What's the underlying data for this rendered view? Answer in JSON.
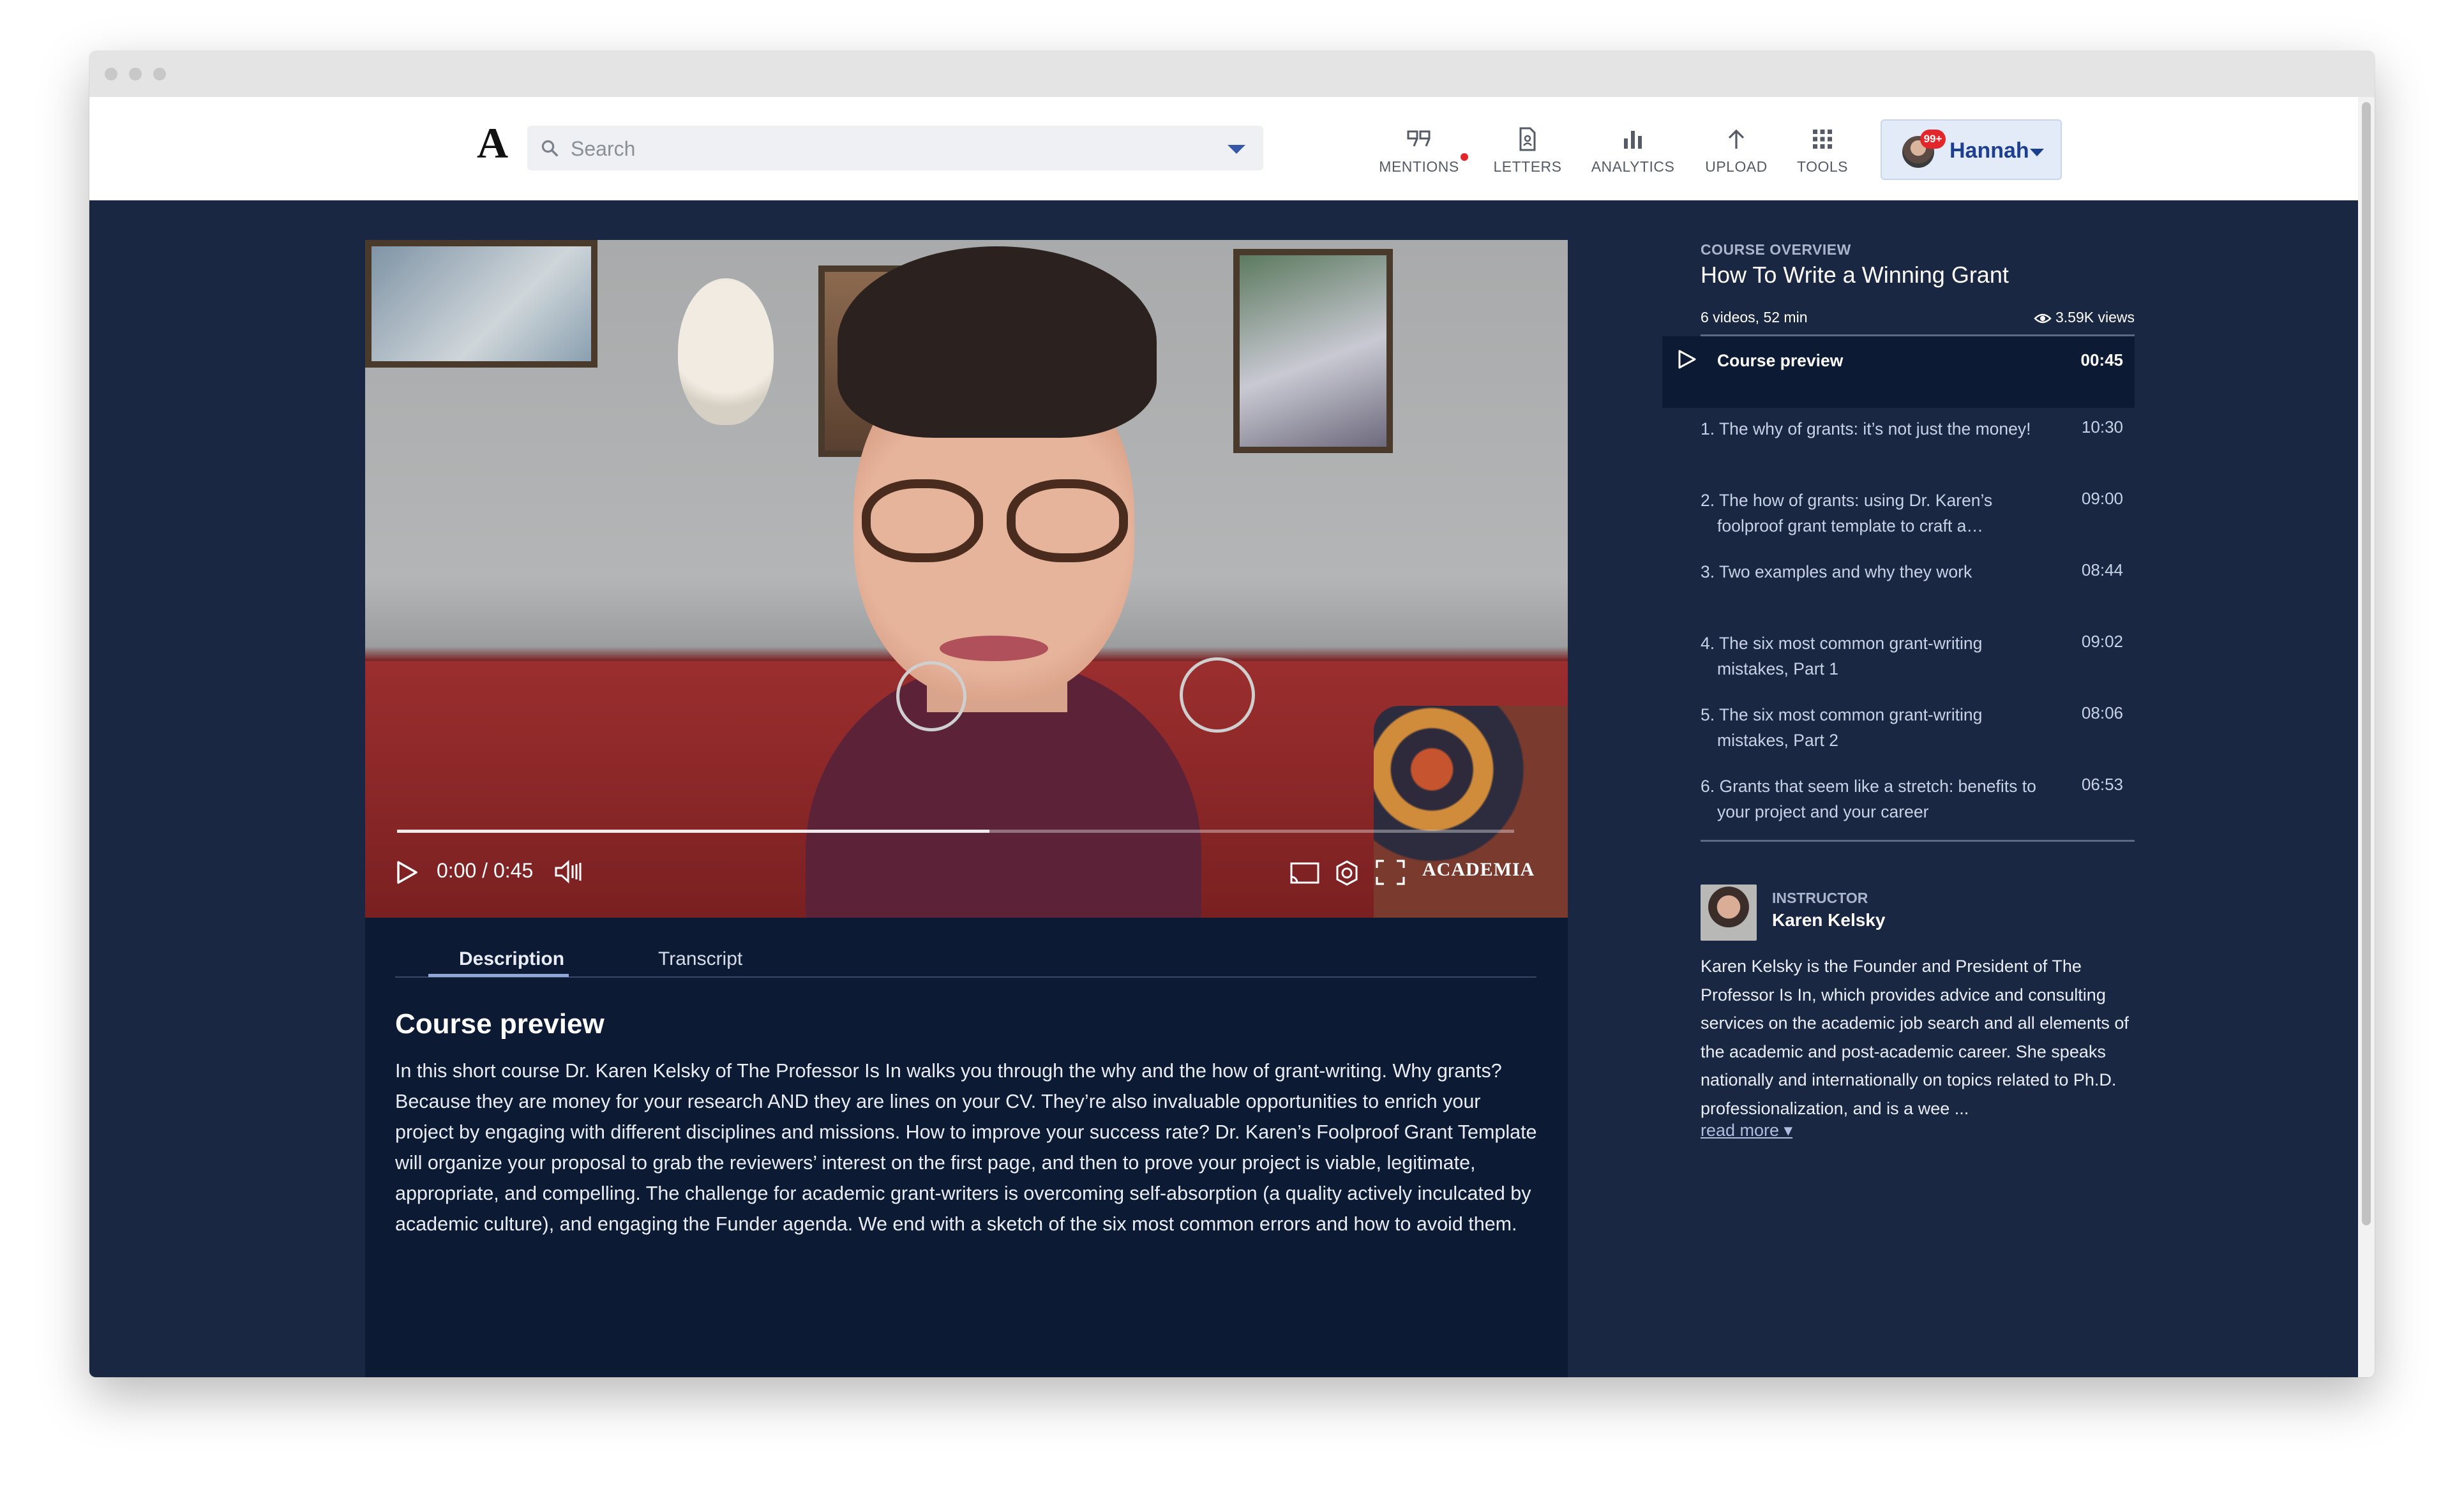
{
  "header": {
    "logo": "A",
    "search_placeholder": "Search",
    "nav": [
      {
        "label": "MENTIONS",
        "icon": "quote-icon"
      },
      {
        "label": "LETTERS",
        "icon": "document-icon"
      },
      {
        "label": "ANALYTICS",
        "icon": "bar-chart-icon"
      },
      {
        "label": "UPLOAD",
        "icon": "arrow-up-icon"
      },
      {
        "label": "TOOLS",
        "icon": "grid-icon"
      }
    ],
    "user": {
      "name": "Hannah",
      "badge": "99+"
    }
  },
  "video": {
    "time": "0:00 / 0:45",
    "progress": 0.53,
    "brand": "ACADEMIA"
  },
  "tabs": {
    "description": "Description",
    "transcript": "Transcript"
  },
  "description": {
    "title": "Course preview",
    "body": "In this short course Dr. Karen Kelsky of The Professor Is In walks you through the why and the how of grant-writing. Why grants? Because they are money for your research AND they are lines on your CV. They’re also invaluable opportunities to enrich your project by engaging with different disciplines and missions. How to improve your success rate? Dr. Karen’s Foolproof Grant Template will organize your proposal to grab the reviewers’ interest on the first page, and then to prove your project is viable, legitimate, appropriate, and compelling. The challenge for academic grant-writers is overcoming self-absorption (a quality actively inculcated by academic culture), and engaging the Funder agenda. We end with a sketch of the six most common errors and how to avoid them."
  },
  "course": {
    "kicker": "COURSE OVERVIEW",
    "title": "How To Write a Winning Grant",
    "meta": "6 videos, 52 min",
    "views": "3.59K views",
    "lessons": [
      {
        "title": "Course preview",
        "duration": "00:45"
      },
      {
        "title": "1. The why of grants: it’s not just the money!",
        "duration": "10:30"
      },
      {
        "title": "2. The how of grants: using Dr. Karen’s foolproof grant template to craft a…",
        "duration": "09:00"
      },
      {
        "title": "3. Two examples and why they work",
        "duration": "08:44"
      },
      {
        "title": "4. The six most common grant-writing mistakes, Part 1",
        "duration": "09:02"
      },
      {
        "title": "5. The six most common grant-writing mistakes, Part 2",
        "duration": "08:06"
      },
      {
        "title": "6. Grants that seem like a stretch: benefits to your project and your career",
        "duration": "06:53"
      }
    ]
  },
  "instructor": {
    "kicker": "INSTRUCTOR",
    "name": "Karen Kelsky",
    "bio": "Karen Kelsky is the Founder and President of The Professor Is In, which provides advice and consulting services on the academic job search and all elements of the academic and post-academic career. She speaks nationally and internationally on topics related to Ph.D. professionalization, and is a wee ...",
    "read_more": "read more ▾"
  }
}
